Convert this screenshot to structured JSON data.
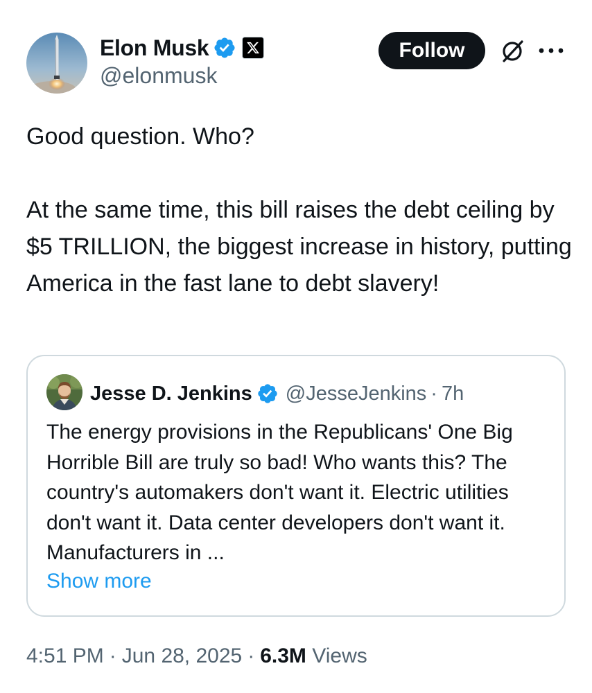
{
  "author": {
    "display_name": "Elon Musk",
    "handle": "@elonmusk"
  },
  "actions": {
    "follow_label": "Follow"
  },
  "tweet": {
    "text": "Good question. Who?\n\nAt the same time, this bill raises the debt ceiling by $5 TRILLION, the biggest increase in history, putting   America in the fast lane to debt slavery!"
  },
  "quote": {
    "display_name": "Jesse D. Jenkins",
    "handle": "@JesseJenkins",
    "separator": "·",
    "time": "7h",
    "text": "The energy provisions in the Republicans' One Big Horrible Bill are truly so bad! Who wants this? The country's automakers don't want it. Electric utilities don't want it. Data center developers don't want it. Manufacturers in ...",
    "show_more_label": "Show more"
  },
  "meta": {
    "time": "4:51 PM",
    "separator": "·",
    "date": "Jun 28, 2025",
    "views_count": "6.3M",
    "views_label": "Views"
  },
  "colors": {
    "text": "#0f1419",
    "secondary": "#536471",
    "link": "#1d9bf0",
    "verified": "#1d9bf0",
    "border": "#cfd9de"
  },
  "icons": {
    "verified": "verified-badge-icon",
    "affiliation": "x-logo-icon",
    "grok": "grok-icon",
    "more": "more-dots-icon"
  }
}
